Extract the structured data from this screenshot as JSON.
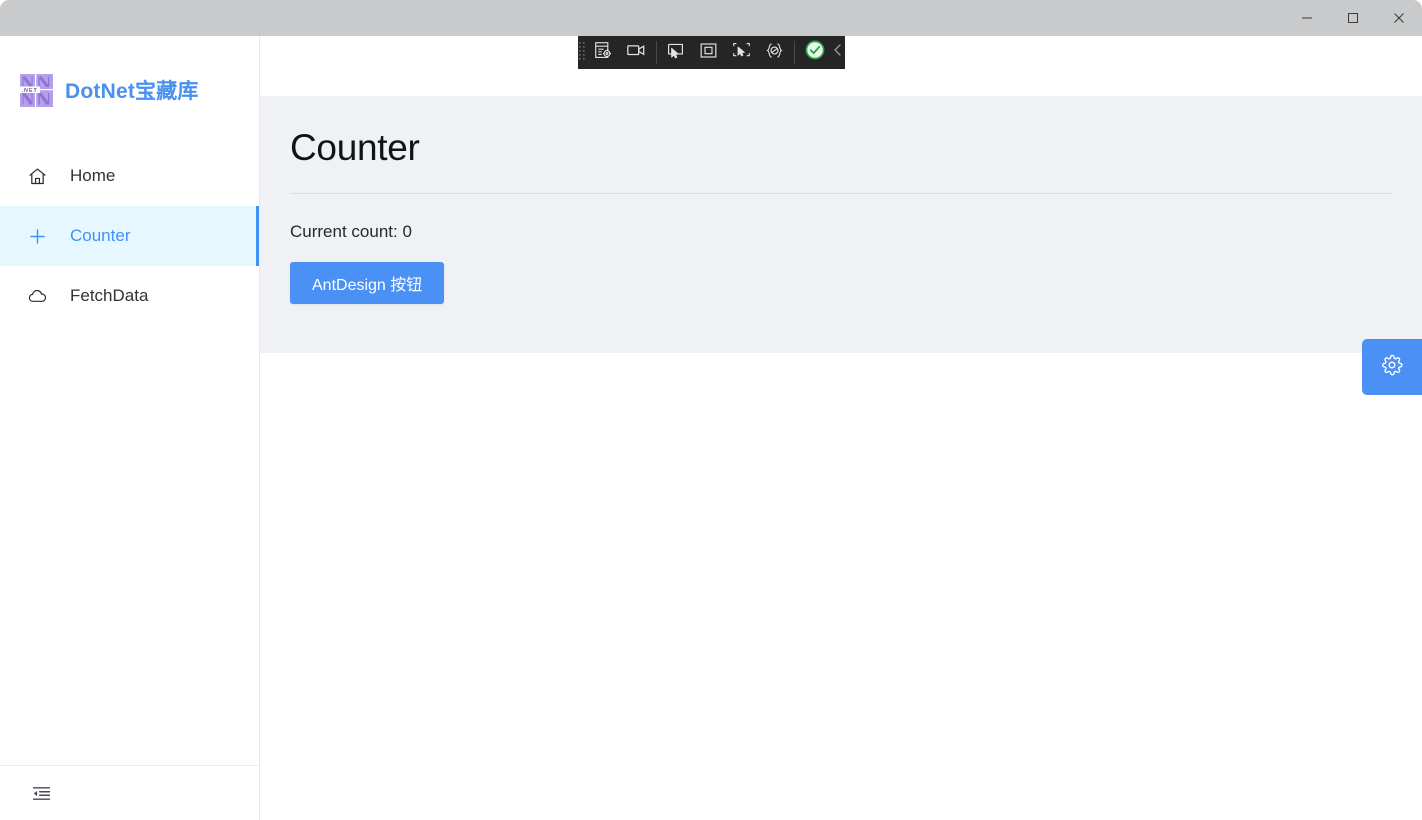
{
  "window": {
    "controls": [
      {
        "name": "minimize-button",
        "icon": "minimize-icon",
        "label": "Minimize"
      },
      {
        "name": "maximize-button",
        "icon": "maximize-icon",
        "label": "Maximize"
      },
      {
        "name": "close-button",
        "icon": "close-icon",
        "label": "Close"
      }
    ]
  },
  "sidebar": {
    "brand": {
      "title": "DotNet宝藏库",
      "logo_icon": "dotnet-logo-icon",
      "logo_text": ".NET",
      "color": "#4a90f0"
    },
    "items": [
      {
        "label": "Home",
        "icon": "home-icon",
        "active": false
      },
      {
        "label": "Counter",
        "icon": "plus-icon",
        "active": true
      },
      {
        "label": "FetchData",
        "icon": "cloud-icon",
        "active": false
      }
    ],
    "active_color": "#4192f5",
    "active_bg": "#e6f7ff",
    "footer": {
      "collapse_icon": "menu-fold-icon",
      "label": "Collapse sidebar"
    }
  },
  "main": {
    "page_title": "Counter",
    "current_count_label": "Current count: 0",
    "count_value": "0",
    "primary_button": {
      "label": "AntDesign 按钮",
      "color": "#4a90f5"
    },
    "panel_bg": "#f0f1f4"
  },
  "settings_fab": {
    "icon": "gear-icon",
    "label": "Settings",
    "color": "#4a90f5"
  },
  "recorder_toolbar": {
    "background": "#252526",
    "drag_handle_icon": "drag-dots-icon",
    "buttons": [
      {
        "name": "inspect-element-button",
        "icon": "inspect-element-icon"
      },
      {
        "name": "record-video-button",
        "icon": "video-camera-icon"
      },
      {
        "name": "pick-locator-button",
        "icon": "cursor-screen-icon"
      },
      {
        "name": "highlight-region-button",
        "icon": "square-outline-icon"
      },
      {
        "name": "select-element-button",
        "icon": "select-element-icon"
      },
      {
        "name": "code-snippet-button",
        "icon": "braces-code-icon"
      },
      {
        "name": "assertion-ok-button",
        "icon": "check-circle-icon"
      }
    ],
    "collapse_icon": "chevron-left-icon"
  }
}
